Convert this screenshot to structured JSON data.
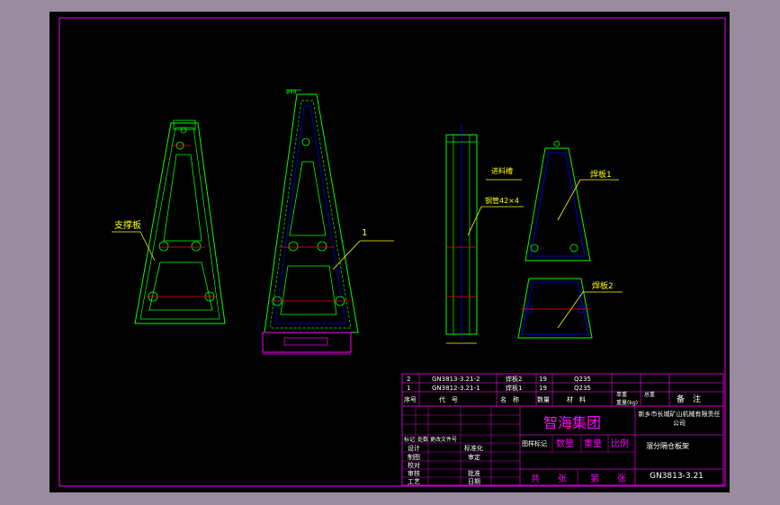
{
  "callouts": {
    "support_plate": "支撑板",
    "item_1": "1",
    "feed_slot": "进料槽",
    "steel_pipe": "钢管42×4",
    "weld_plate_1": "焊板1",
    "weld_plate_2": "焊板2"
  },
  "parts_list": {
    "rows": [
      {
        "no": "2",
        "code": "GN3813-3.21-2",
        "name": "焊板2",
        "qty": "19",
        "material": "Q235"
      },
      {
        "no": "1",
        "code": "GN3812-3.21-1",
        "name": "焊板1",
        "qty": "19",
        "material": "Q235"
      }
    ],
    "header": {
      "no": "序号",
      "code": "代　号",
      "name": "名　称",
      "qty": "数量",
      "material": "材　料",
      "unit_weight": "单重",
      "total_weight": "总重",
      "weight_unit": "重量(kg)",
      "remark": "备　注"
    }
  },
  "title_block": {
    "company_logo": "智海集团",
    "maker": "新乡市长城矿山机械有限责任公司",
    "drawing_title": "溜分隔仓板架",
    "drawing_no": "GN3813-3.21",
    "stage_mark": "图样标记",
    "quantity": "数量",
    "weight": "重量",
    "scale": "比例",
    "sheets_total": "共　　张",
    "sheet_no": "第　　张",
    "rows": {
      "mark": "标记",
      "count": "处数",
      "file_no": "更改文件号",
      "design": "设计",
      "standardize": "标准化",
      "draw": "制图",
      "review": "审定",
      "check": "校对",
      "audit": "审核",
      "approve": "批准",
      "process": "工艺",
      "date": "日期"
    }
  },
  "colors": {
    "background": "#000000",
    "frame": "#c800c8",
    "green": "#00ff00",
    "yellow": "#ffff00",
    "red": "#ff0000",
    "blue": "#0000ff",
    "magenta": "#ff00ff",
    "white": "#ffffff"
  }
}
